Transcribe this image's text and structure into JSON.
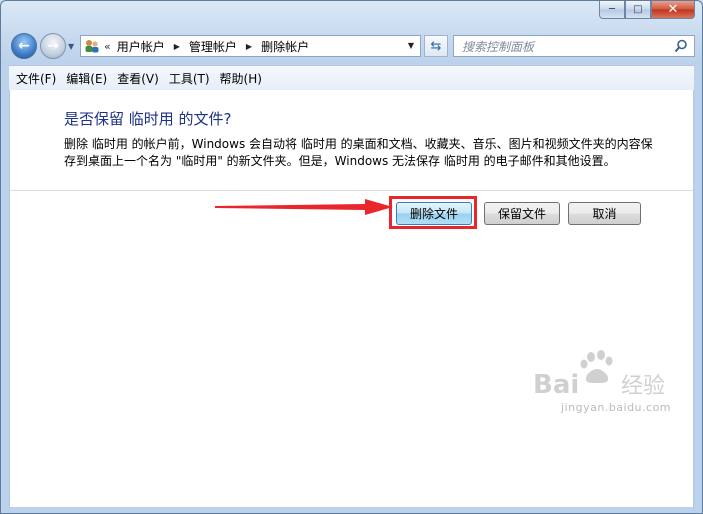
{
  "window": {
    "caption_buttons": {
      "minimize_icon": "minimize-icon",
      "maximize_icon": "maximize-icon",
      "close_icon": "close-icon"
    }
  },
  "navigation": {
    "address_chevron": "«",
    "breadcrumbs": [
      "用户帐户",
      "管理帐户",
      "删除帐户"
    ],
    "search_placeholder": "搜索控制面板"
  },
  "menu": {
    "items": [
      "文件(F)",
      "编辑(E)",
      "查看(V)",
      "工具(T)",
      "帮助(H)"
    ]
  },
  "dialog": {
    "title": "是否保留 临时用 的文件?",
    "description": "删除 临时用 的帐户前，Windows 会自动将 临时用 的桌面和文档、收藏夹、音乐、图片和视频文件夹的内容保存到桌面上一个名为 \"临时用\" 的新文件夹。但是，Windows 无法保存 临时用 的电子邮件和其他设置。",
    "buttons": {
      "delete_files": "删除文件",
      "keep_files": "保留文件",
      "cancel": "取消"
    }
  },
  "annotation": {
    "highlight_color": "#e8262c",
    "arrow_color": "#e8262c"
  },
  "watermark": {
    "logo_text": "Baidu经验",
    "url": "jingyan.baidu.com"
  }
}
